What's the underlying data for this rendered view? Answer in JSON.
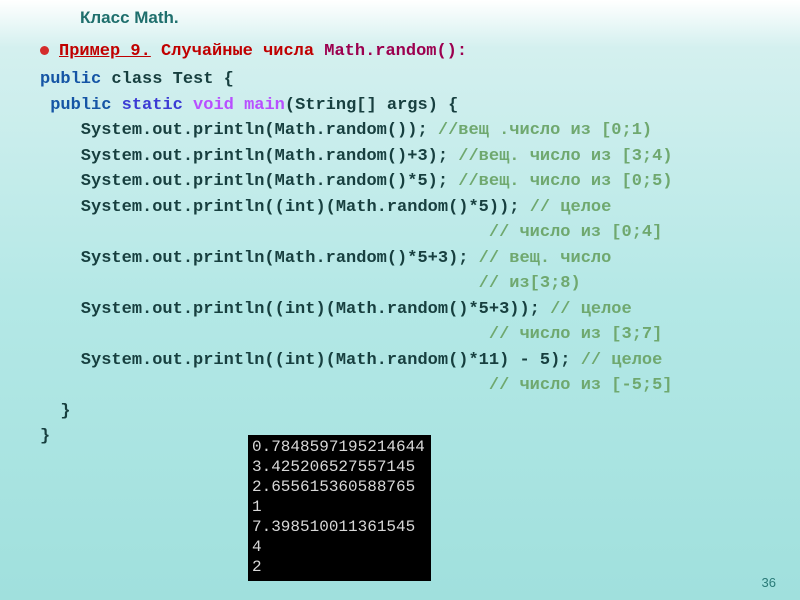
{
  "header": "Класс Math.",
  "example": {
    "label": "Пример 9.",
    "desc": " Случайные числа ",
    "call": "Math.random():"
  },
  "code": {
    "l1a": "public class ",
    "l1b": "Test {",
    "l2a": " public static void ",
    "l2b": "main",
    "l2c": "(String[] args) {",
    "pub": "public",
    "cls": " class ",
    "stat": " static ",
    "vd": "void ",
    "l3a": "    System.out.println(Math.random()); ",
    "l3c": "//вещ .число из [0;1)",
    "l4a": "    System.out.println(Math.random()+3); ",
    "l4c": "//вещ. число из [3;4)",
    "l5a": "    System.out.println(Math.random()*5); ",
    "l5c": "//вещ. число из [0;5)",
    "l6a": "    System.out.println((int)(Math.random()*5)); ",
    "l6c": "// целое",
    "l6d": "                                            ",
    "l6e": "// число из [0;4]",
    "l7a": "    System.out.println(Math.random()*5+3); ",
    "l7c": "// вещ. число",
    "l7d": "                                           ",
    "l7e": "// из[3;8)",
    "l8a": "    System.out.println((int)(Math.random()*5+3)); ",
    "l8c": "// целое",
    "l8d": "                                            ",
    "l8e": "// число из [3;7]",
    "l9a": "    System.out.println((int)(Math.random()*11) - 5); ",
    "l9c": "// целое",
    "l9d": "                                            ",
    "l9e": "// число из [-5;5]",
    "l10": "  }",
    "l11": "}"
  },
  "output": [
    "0.7848597195214644",
    "3.425206527557145",
    "2.655615360588765",
    "1",
    "7.398510011361545",
    "4",
    "2"
  ],
  "page": "36"
}
